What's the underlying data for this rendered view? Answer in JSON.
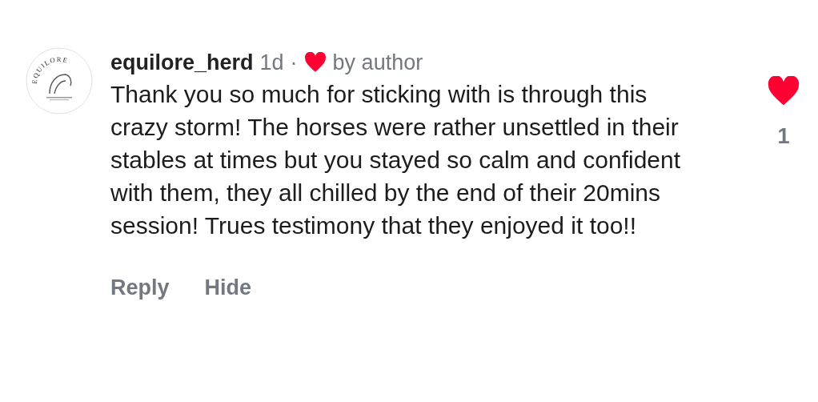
{
  "comment": {
    "avatar": {
      "logo_text": "EQUILORE"
    },
    "username": "equilore_herd",
    "time": "1d",
    "separator": "·",
    "liked_by_author": true,
    "author_label": "by author",
    "text": "Thank you so much for sticking with is through this crazy storm! The horses were rather unsettled in their stables at times but you stayed so calm and confident with them, they all chilled by the end of their 20mins session! Trues testimony that they enjoyed it too!!",
    "actions": [
      "Reply",
      "Hide"
    ],
    "liked": true,
    "like_count": "1"
  }
}
